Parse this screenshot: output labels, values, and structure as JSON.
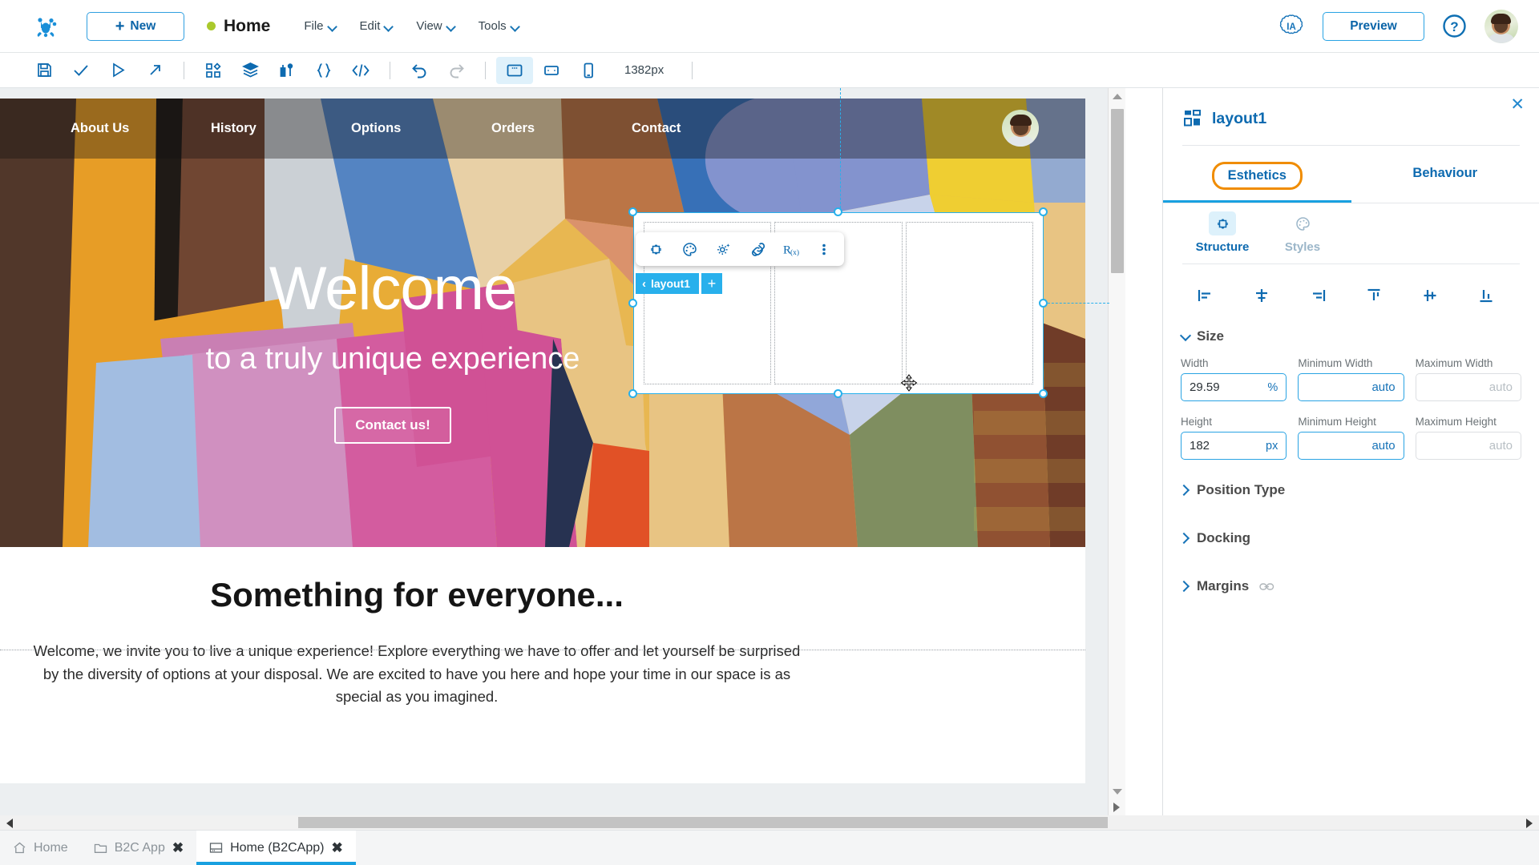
{
  "header": {
    "logo_icon": "frog-logo-icon",
    "new_button": "New",
    "status_dot_color": "#aac92c",
    "document_title": "Home",
    "menus": [
      "File",
      "Edit",
      "View",
      "Tools"
    ],
    "ia_badge": "IA",
    "preview_button": "Preview",
    "help_icon": "question-circle-icon",
    "avatar": "user-avatar"
  },
  "toolbar": {
    "icons": [
      "save-icon",
      "check-icon",
      "play-icon",
      "publish-icon",
      "components-icon",
      "layers-icon",
      "data-icon",
      "braces-icon",
      "code-icon",
      "undo-icon",
      "redo-icon",
      "desktop-icon",
      "tablet-icon",
      "phone-icon"
    ],
    "viewport_size": "1382px"
  },
  "canvas": {
    "nav_links": [
      "About Us",
      "History",
      "Options",
      "Orders",
      "Contact"
    ],
    "hero_title": "Welcome",
    "hero_subtitle": "to a truly unique experience",
    "hero_button": "Contact us!",
    "section_title": "Something for everyone...",
    "section_paragraph": "Welcome, we invite you to live a unique experience! Explore everything we have to offer and let yourself be surprised by the diversity of options at your disposal. We are excited to have you here and hope your time in our space is as special as you imagined.",
    "floating_toolbar_icons": [
      "structure-icon",
      "palette-icon",
      "settings-sparkle-icon",
      "link-icon",
      "expression-icon",
      "more-vertical-icon"
    ],
    "breadcrumb_label": "layout1",
    "breadcrumb_add": "+"
  },
  "panel": {
    "element_icon": "layout-grid-icon",
    "element_name": "layout1",
    "close_icon": "close-icon",
    "tabs": [
      {
        "label": "Esthetics",
        "selected": true
      },
      {
        "label": "Behaviour",
        "selected": false
      }
    ],
    "subtabs": [
      {
        "label": "Structure",
        "icon": "structure-icon",
        "selected": true
      },
      {
        "label": "Styles",
        "icon": "palette-icon",
        "selected": false
      }
    ],
    "align_icons": [
      "align-left-icon",
      "align-center-horizontal-icon",
      "align-right-icon",
      "align-top-icon",
      "align-center-vertical-icon",
      "align-bottom-icon"
    ],
    "sections": [
      {
        "label": "Size",
        "expanded": true
      },
      {
        "label": "Position Type",
        "expanded": false
      },
      {
        "label": "Docking",
        "expanded": false
      },
      {
        "label": "Margins",
        "expanded": false,
        "link_icon": "link-chain-icon"
      }
    ],
    "size_fields": [
      {
        "label": "Width",
        "value": "29.59",
        "unit": "%",
        "placeholder": "",
        "active": true
      },
      {
        "label": "Minimum Width",
        "value": "",
        "unit": "",
        "placeholder": "auto",
        "active": true
      },
      {
        "label": "Maximum Width",
        "value": "",
        "unit": "",
        "placeholder": "auto",
        "active": false
      },
      {
        "label": "Height",
        "value": "182",
        "unit": "px",
        "placeholder": "",
        "active": true
      },
      {
        "label": "Minimum Height",
        "value": "",
        "unit": "",
        "placeholder": "auto",
        "active": true
      },
      {
        "label": "Maximum Height",
        "value": "",
        "unit": "",
        "placeholder": "auto",
        "active": false
      }
    ]
  },
  "bottom_tabs": [
    {
      "label": "Home",
      "icon": "home-icon",
      "closable": false,
      "active": false
    },
    {
      "label": "B2C App",
      "icon": "folder-icon",
      "closable": true,
      "active": false
    },
    {
      "label": "Home (B2CApp)",
      "icon": "screen-icon",
      "closable": true,
      "active": true
    }
  ]
}
